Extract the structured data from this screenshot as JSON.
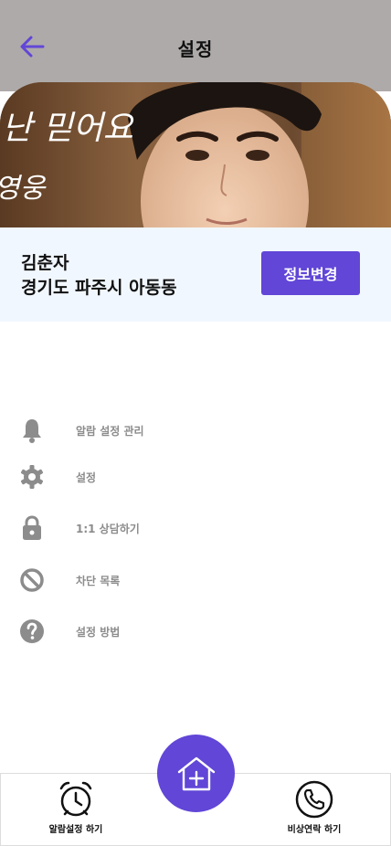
{
  "header": {
    "title": "설정",
    "back_icon": "arrow-left-icon",
    "back_color": "#6146d7",
    "background": "#aeaaa9"
  },
  "banner": {
    "caption_line1": "난 믿어요",
    "caption_line2": "영웅"
  },
  "profile": {
    "name": "김춘자",
    "address": "경기도 파주시 아동동",
    "edit_label": "정보변경",
    "background": "#f1f7fe"
  },
  "menu": {
    "items": [
      {
        "label": "알람 설정 관리",
        "icon": "bell-icon"
      },
      {
        "label": "설정",
        "icon": "gear-icon"
      },
      {
        "label": "1:1 상담하기",
        "icon": "lock-icon"
      },
      {
        "label": "차단 목록",
        "icon": "block-icon"
      },
      {
        "label": "설정 방법",
        "icon": "help-icon"
      }
    ],
    "icon_color": "#8c8c8c"
  },
  "bottom_nav": {
    "alarm_label": "알람설정 하기",
    "alarm_icon": "alarm-clock-icon",
    "call_label": "비상연락 하기",
    "call_icon": "phone-icon",
    "home_icon": "home-add-icon"
  },
  "accent_color": "#6146d7"
}
